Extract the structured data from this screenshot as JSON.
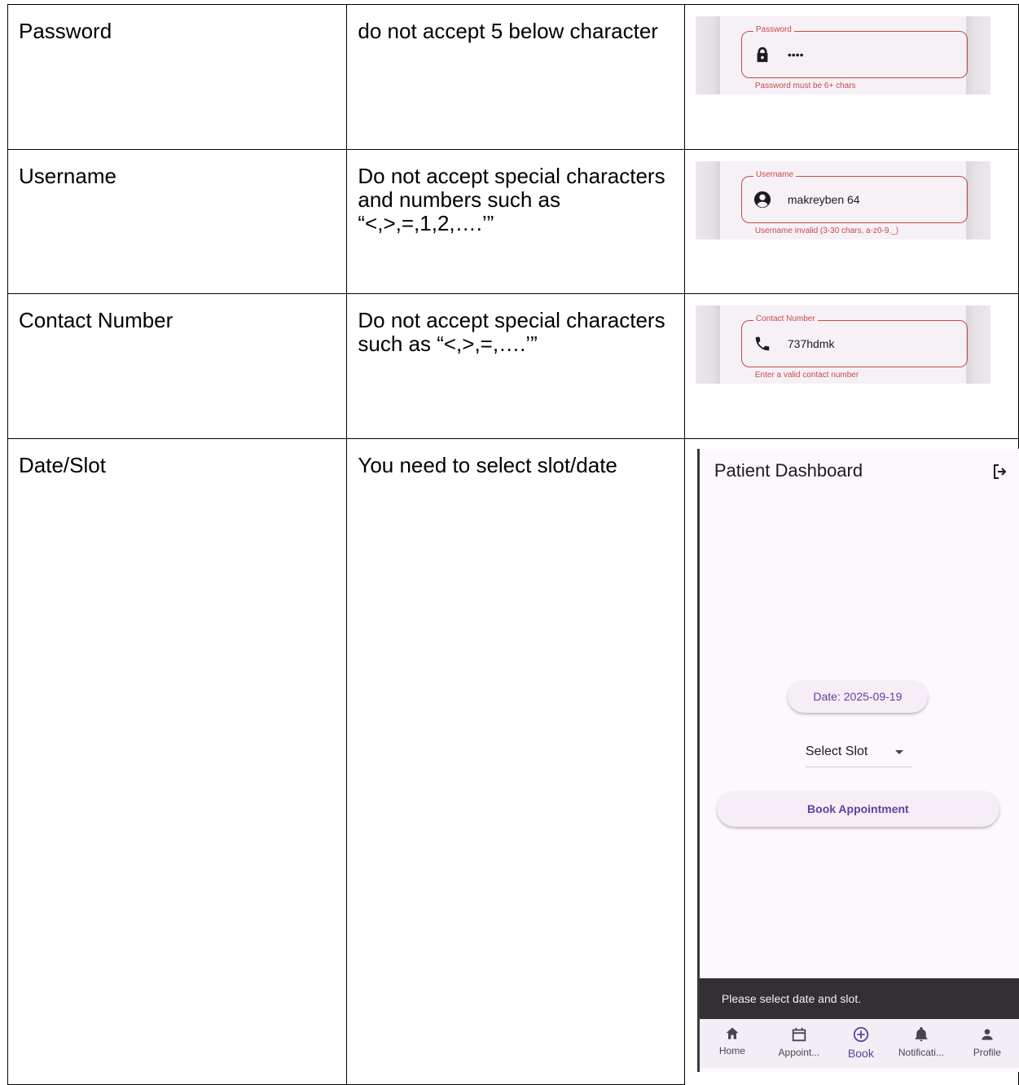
{
  "rows": [
    {
      "field": "Password",
      "rule": "do not accept 5 below character",
      "shot": {
        "label": "Password",
        "value": "••••",
        "icon": "lock-icon",
        "error": "Password must be 6+ chars"
      }
    },
    {
      "field": "Username",
      "rule": "Do not accept special characters and numbers such as “<,>,=,1,2,….’”",
      "shot": {
        "label": "Username",
        "value": "makreyben 64",
        "icon": "account-circle-icon",
        "error": "Username invalid (3-30 chars, a-z0-9._)"
      }
    },
    {
      "field": "Contact Number",
      "rule": "Do not accept special characters such as “<,>,=,….’”",
      "shot": {
        "label": "Contact Number",
        "value": "737hdmk",
        "icon": "phone-icon",
        "error": "Enter a valid contact number"
      }
    },
    {
      "field": "Date/Slot",
      "rule": "You need to select slot/date"
    }
  ],
  "dashboard": {
    "title": "Patient Dashboard",
    "date_button": "Date: 2025-09-19",
    "slot_select": "Select Slot",
    "book_button": "Book Appointment",
    "snackbar": "Please select date and slot.",
    "nav": [
      {
        "label": "Home",
        "icon": "home-icon"
      },
      {
        "label": "Appoint...",
        "icon": "calendar-icon"
      },
      {
        "label": "Book",
        "icon": "add-circle-icon",
        "active": true
      },
      {
        "label": "Notificati...",
        "icon": "bell-icon"
      },
      {
        "label": "Profile",
        "icon": "person-icon"
      }
    ]
  },
  "colors": {
    "error": "#c64a4a",
    "accent": "#5a44a0",
    "phone_bg": "#fdf7fe"
  }
}
